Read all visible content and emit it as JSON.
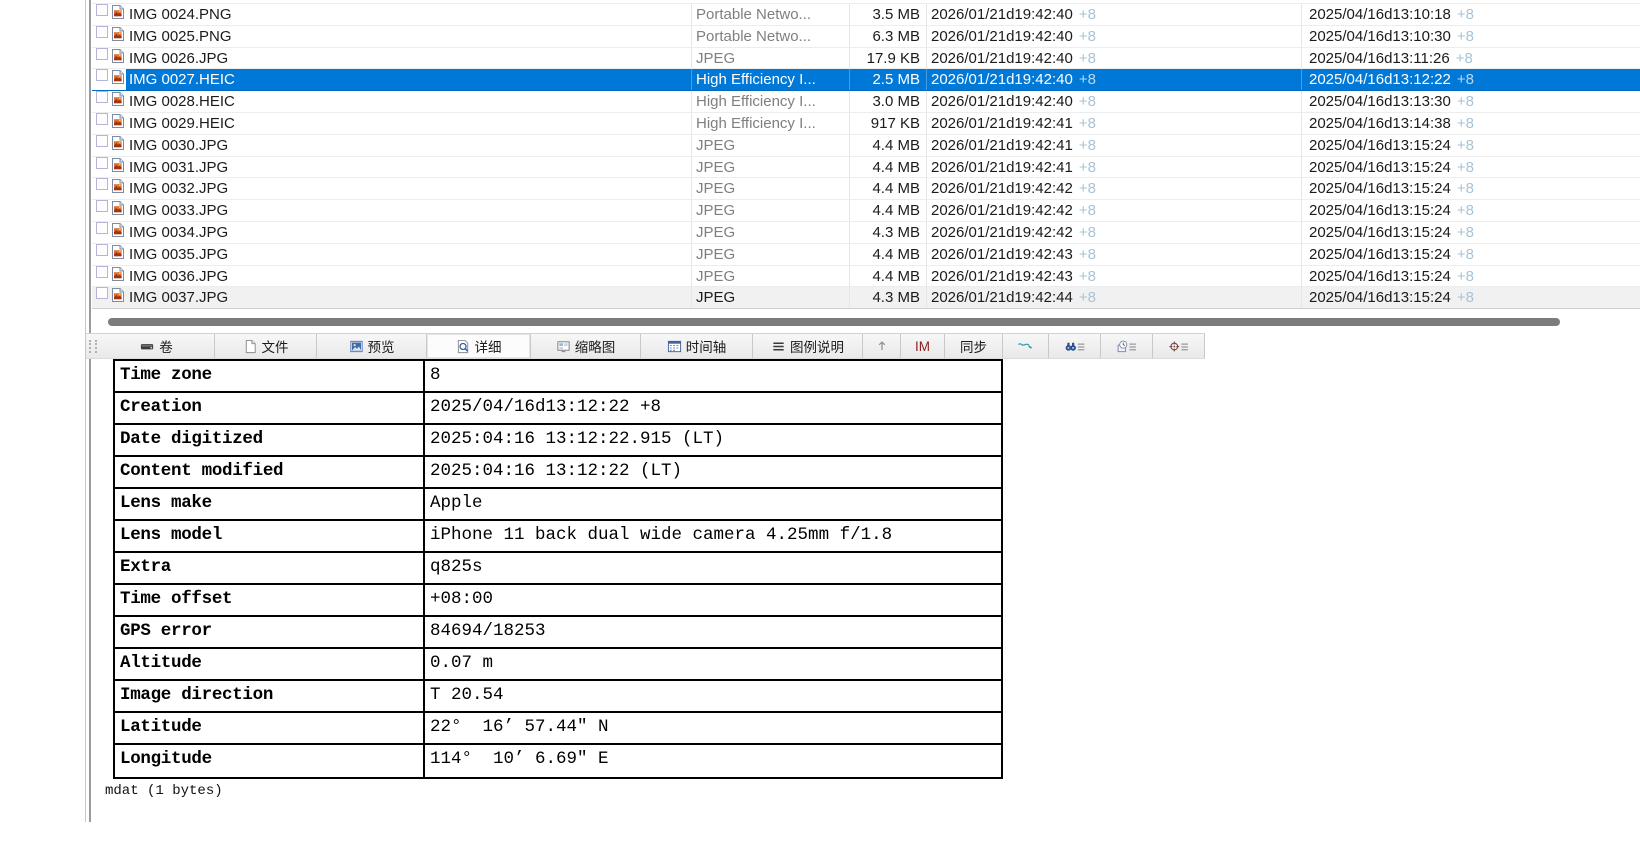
{
  "file_list": {
    "row_icon": "image-file-icon",
    "timezone_suffix": "+8",
    "rows": [
      {
        "name": "IMG 0024.PNG",
        "type": "Portable Netwo...",
        "size": "3.5 MB",
        "modified": "2026/01/21d19:42:40",
        "created": "2025/04/16d13:10:18",
        "selected": false,
        "hot": false
      },
      {
        "name": "IMG 0025.PNG",
        "type": "Portable Netwo...",
        "size": "6.3 MB",
        "modified": "2026/01/21d19:42:40",
        "created": "2025/04/16d13:10:30",
        "selected": false,
        "hot": false
      },
      {
        "name": "IMG 0026.JPG",
        "type": "JPEG",
        "size": "17.9 KB",
        "modified": "2026/01/21d19:42:40",
        "created": "2025/04/16d13:11:26",
        "selected": false,
        "hot": false
      },
      {
        "name": "IMG 0027.HEIC",
        "type": "High Efficiency I...",
        "size": "2.5 MB",
        "modified": "2026/01/21d19:42:40",
        "created": "2025/04/16d13:12:22",
        "selected": true,
        "hot": false
      },
      {
        "name": "IMG 0028.HEIC",
        "type": "High Efficiency I...",
        "size": "3.0 MB",
        "modified": "2026/01/21d19:42:40",
        "created": "2025/04/16d13:13:30",
        "selected": false,
        "hot": false
      },
      {
        "name": "IMG 0029.HEIC",
        "type": "High Efficiency I...",
        "size": "917 KB",
        "modified": "2026/01/21d19:42:41",
        "created": "2025/04/16d13:14:38",
        "selected": false,
        "hot": false
      },
      {
        "name": "IMG 0030.JPG",
        "type": "JPEG",
        "size": "4.4 MB",
        "modified": "2026/01/21d19:42:41",
        "created": "2025/04/16d13:15:24",
        "selected": false,
        "hot": false
      },
      {
        "name": "IMG 0031.JPG",
        "type": "JPEG",
        "size": "4.4 MB",
        "modified": "2026/01/21d19:42:41",
        "created": "2025/04/16d13:15:24",
        "selected": false,
        "hot": false
      },
      {
        "name": "IMG 0032.JPG",
        "type": "JPEG",
        "size": "4.4 MB",
        "modified": "2026/01/21d19:42:42",
        "created": "2025/04/16d13:15:24",
        "selected": false,
        "hot": false
      },
      {
        "name": "IMG 0033.JPG",
        "type": "JPEG",
        "size": "4.4 MB",
        "modified": "2026/01/21d19:42:42",
        "created": "2025/04/16d13:15:24",
        "selected": false,
        "hot": false
      },
      {
        "name": "IMG 0034.JPG",
        "type": "JPEG",
        "size": "4.3 MB",
        "modified": "2026/01/21d19:42:42",
        "created": "2025/04/16d13:15:24",
        "selected": false,
        "hot": false
      },
      {
        "name": "IMG 0035.JPG",
        "type": "JPEG",
        "size": "4.4 MB",
        "modified": "2026/01/21d19:42:43",
        "created": "2025/04/16d13:15:24",
        "selected": false,
        "hot": false
      },
      {
        "name": "IMG 0036.JPG",
        "type": "JPEG",
        "size": "4.4 MB",
        "modified": "2026/01/21d19:42:43",
        "created": "2025/04/16d13:15:24",
        "selected": false,
        "hot": false
      },
      {
        "name": "IMG 0037.JPG",
        "type": "JPEG",
        "size": "4.3 MB",
        "modified": "2026/01/21d19:42:44",
        "created": "2025/04/16d13:15:24",
        "selected": false,
        "hot": true
      }
    ]
  },
  "toolbar": {
    "items": [
      {
        "type": "grip",
        "name": "toolbar-drag-grip"
      },
      {
        "type": "tab",
        "name": "tab-volume",
        "icon": "volume-icon",
        "label": "卷",
        "active": false
      },
      {
        "type": "tab",
        "name": "tab-file",
        "icon": "file-icon",
        "label": "文件",
        "active": false
      },
      {
        "type": "tab",
        "name": "tab-preview",
        "icon": "preview-icon",
        "label": "预览",
        "active": false
      },
      {
        "type": "tab",
        "name": "tab-detail",
        "icon": "detail-icon",
        "label": "详细",
        "active": true
      },
      {
        "type": "tab",
        "name": "tab-thumbnail",
        "icon": "thumbnail-icon",
        "label": "缩略图",
        "active": false
      },
      {
        "type": "tab",
        "name": "tab-timeline",
        "icon": "timeline-icon",
        "label": "时间轴",
        "active": false
      },
      {
        "type": "tab",
        "name": "tab-legend",
        "icon": "legend-icon",
        "label": "图例说明",
        "active": false
      },
      {
        "type": "button",
        "name": "up-button",
        "icon": "up-arrow-icon",
        "label": ""
      },
      {
        "type": "button",
        "name": "im-button",
        "label": "IM",
        "color": "#8b2222"
      },
      {
        "type": "button",
        "name": "sync-button",
        "label": "同步"
      },
      {
        "type": "button",
        "name": "wave-sync-button",
        "icon": "wave-icon",
        "label": ""
      },
      {
        "type": "button",
        "name": "find-button",
        "icon": "find-list-icon",
        "label": ""
      },
      {
        "type": "button",
        "name": "history-button",
        "icon": "clock-list-icon",
        "label": ""
      },
      {
        "type": "button",
        "name": "target-button",
        "icon": "target-list-icon",
        "label": ""
      }
    ]
  },
  "details": {
    "rows": [
      {
        "label": "Time zone",
        "value": "8"
      },
      {
        "label": "Creation",
        "value": "2025/04/16d13:12:22 +8"
      },
      {
        "label": "Date digitized",
        "value": "2025:04:16 13:12:22.915 (LT)"
      },
      {
        "label": "Content modified",
        "value": "2025:04:16 13:12:22 (LT)"
      },
      {
        "label": "Lens make",
        "value": "Apple"
      },
      {
        "label": "Lens model",
        "value": "iPhone 11 back dual wide camera 4.25mm f/1.8"
      },
      {
        "label": "Extra",
        "value": "q825s"
      },
      {
        "label": "Time offset",
        "value": "+08:00"
      },
      {
        "label": "GPS error",
        "value": "84694/18253"
      },
      {
        "label": "Altitude",
        "value": "0.07 m"
      },
      {
        "label": "Image direction",
        "value": "T 20.54"
      },
      {
        "label": "Latitude",
        "value": "22°  16’ 57.44″ N"
      },
      {
        "label": "Longitude",
        "value": "114°  10’ 6.69″ E"
      }
    ]
  },
  "footer": {
    "text": "mdat (1 bytes)"
  },
  "colors": {
    "selection_blue": "#0078d7",
    "timezone_suffix": "#a9c3d6",
    "muted_type_text": "#7f7f7f",
    "im_text": "#8b2222",
    "wave_teal": "#2a9d9d",
    "hot_row_bg": "#f1f1f1",
    "scrollbar_thumb": "#7c7c7c"
  }
}
